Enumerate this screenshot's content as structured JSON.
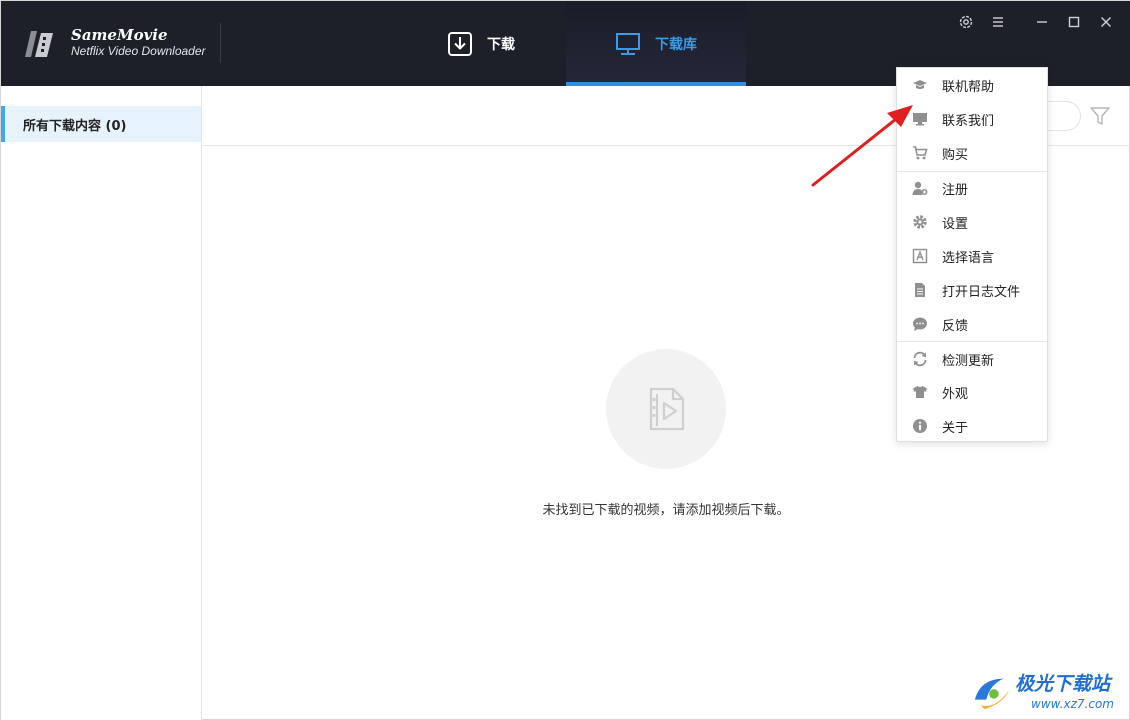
{
  "brand": {
    "title": "SameMovie",
    "subtitle": "Netflix Video Downloader"
  },
  "nav": {
    "download_label": "下载",
    "library_label": "下载库",
    "active": "library"
  },
  "sidebar": {
    "items": [
      {
        "label": "所有下载内容 (0)"
      }
    ]
  },
  "main": {
    "empty_message": "未找到已下载的视频，请添加视频后下载。"
  },
  "menu": {
    "items": [
      {
        "label": "联机帮助",
        "icon": "graduation-cap-icon"
      },
      {
        "label": "联系我们",
        "icon": "monitor-icon"
      },
      {
        "label": "购买",
        "icon": "cart-icon"
      },
      {
        "label": "注册",
        "icon": "user-plus-icon"
      },
      {
        "label": "设置",
        "icon": "gear-icon"
      },
      {
        "label": "选择语言",
        "icon": "language-icon"
      },
      {
        "label": "打开日志文件",
        "icon": "document-icon"
      },
      {
        "label": "反馈",
        "icon": "chat-bubble-icon"
      },
      {
        "label": "检测更新",
        "icon": "refresh-icon"
      },
      {
        "label": "外观",
        "icon": "tshirt-icon"
      },
      {
        "label": "关于",
        "icon": "info-icon"
      }
    ]
  },
  "watermark": {
    "text": "极光下载站",
    "url": "www.xz7.com"
  },
  "colors": {
    "header_bg": "#1e2029",
    "accent": "#2f8fe0",
    "sidebar_active_bg": "#e6f3fc",
    "annotation_arrow": "#e02020"
  }
}
